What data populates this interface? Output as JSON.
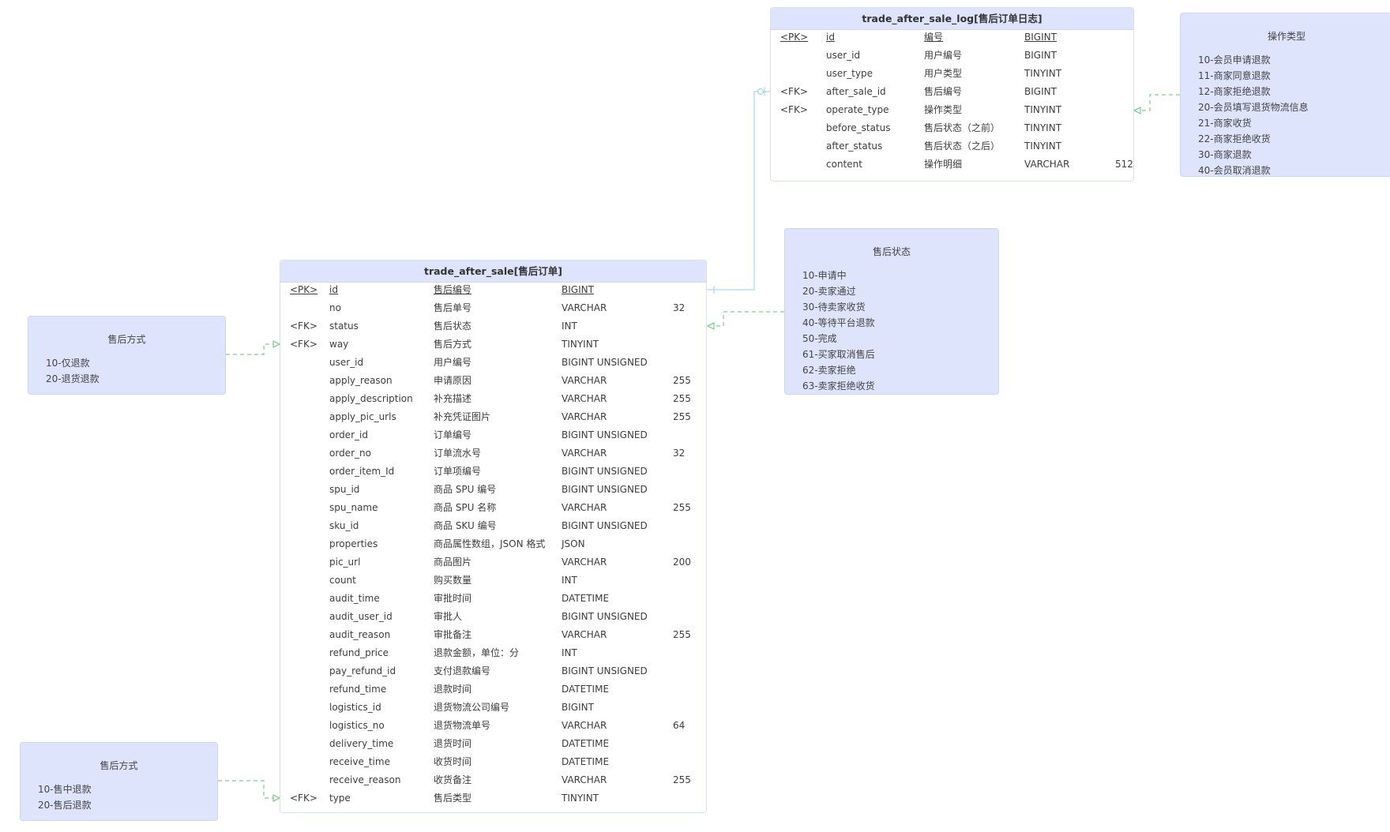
{
  "colors": {
    "header_bg": "#dde4fb",
    "note_bg": "#dde4fb",
    "entity_border": "#d8dff2",
    "relation_line": "#8fd0e8",
    "dependency_line": "#5cc46c"
  },
  "entities": {
    "log": {
      "title": "trade_after_sale_log[售后订单日志]",
      "rows": [
        {
          "key": "<PK>",
          "name": "id",
          "comment": "编号",
          "type": "BIGINT",
          "len": ""
        },
        {
          "key": "",
          "name": "user_id",
          "comment": "用户编号",
          "type": "BIGINT",
          "len": ""
        },
        {
          "key": "",
          "name": "user_type",
          "comment": "用户类型",
          "type": "TINYINT",
          "len": ""
        },
        {
          "key": "<FK>",
          "name": "after_sale_id",
          "comment": "售后编号",
          "type": "BIGINT",
          "len": ""
        },
        {
          "key": "<FK>",
          "name": "operate_type",
          "comment": "操作类型",
          "type": "TINYINT",
          "len": ""
        },
        {
          "key": "",
          "name": "before_status",
          "comment": "售后状态（之前）",
          "type": "TINYINT",
          "len": ""
        },
        {
          "key": "",
          "name": "after_status",
          "comment": "售后状态（之后）",
          "type": "TINYINT",
          "len": ""
        },
        {
          "key": "",
          "name": "content",
          "comment": "操作明细",
          "type": "VARCHAR",
          "len": "512"
        }
      ]
    },
    "sale": {
      "title": "trade_after_sale[售后订单]",
      "rows": [
        {
          "key": "<PK>",
          "name": "id",
          "comment": "售后编号",
          "type": "BIGINT",
          "len": ""
        },
        {
          "key": "",
          "name": "no",
          "comment": "售后单号",
          "type": "VARCHAR",
          "len": "32"
        },
        {
          "key": "<FK>",
          "name": "status",
          "comment": "售后状态",
          "type": "INT",
          "len": ""
        },
        {
          "key": "<FK>",
          "name": "way",
          "comment": "售后方式",
          "type": "TINYINT",
          "len": ""
        },
        {
          "key": "",
          "name": "user_id",
          "comment": "用户编号",
          "type": "BIGINT UNSIGNED",
          "len": ""
        },
        {
          "key": "",
          "name": "apply_reason",
          "comment": "申请原因",
          "type": "VARCHAR",
          "len": "255"
        },
        {
          "key": "",
          "name": "apply_description",
          "comment": "补充描述",
          "type": "VARCHAR",
          "len": "255"
        },
        {
          "key": "",
          "name": "apply_pic_urls",
          "comment": "补充凭证图片",
          "type": "VARCHAR",
          "len": "255"
        },
        {
          "key": "",
          "name": "order_id",
          "comment": "订单编号",
          "type": "BIGINT UNSIGNED",
          "len": ""
        },
        {
          "key": "",
          "name": "order_no",
          "comment": "订单流水号",
          "type": "VARCHAR",
          "len": "32"
        },
        {
          "key": "",
          "name": "order_item_Id",
          "comment": "订单项编号",
          "type": "BIGINT UNSIGNED",
          "len": ""
        },
        {
          "key": "",
          "name": "spu_id",
          "comment": "商品 SPU 编号",
          "type": "BIGINT UNSIGNED",
          "len": ""
        },
        {
          "key": "",
          "name": "spu_name",
          "comment": "商品 SPU 名称",
          "type": "VARCHAR",
          "len": "255"
        },
        {
          "key": "",
          "name": "sku_id",
          "comment": "商品 SKU 编号",
          "type": "BIGINT UNSIGNED",
          "len": ""
        },
        {
          "key": "",
          "name": "properties",
          "comment": "商品属性数组，JSON 格式",
          "type": "JSON",
          "len": ""
        },
        {
          "key": "",
          "name": "pic_url",
          "comment": "商品图片",
          "type": "VARCHAR",
          "len": "200"
        },
        {
          "key": "",
          "name": "count",
          "comment": "购买数量",
          "type": "INT",
          "len": ""
        },
        {
          "key": "",
          "name": "audit_time",
          "comment": "审批时间",
          "type": "DATETIME",
          "len": ""
        },
        {
          "key": "",
          "name": "audit_user_id",
          "comment": "审批人",
          "type": "BIGINT UNSIGNED",
          "len": ""
        },
        {
          "key": "",
          "name": "audit_reason",
          "comment": "审批备注",
          "type": "VARCHAR",
          "len": "255"
        },
        {
          "key": "",
          "name": "refund_price",
          "comment": "退款金额，单位：分",
          "type": "INT",
          "len": ""
        },
        {
          "key": "",
          "name": "pay_refund_id",
          "comment": "支付退款编号",
          "type": "BIGINT UNSIGNED",
          "len": ""
        },
        {
          "key": "",
          "name": "refund_time",
          "comment": "退款时间",
          "type": "DATETIME",
          "len": ""
        },
        {
          "key": "",
          "name": "logistics_id",
          "comment": "退货物流公司编号",
          "type": "BIGINT",
          "len": ""
        },
        {
          "key": "",
          "name": "logistics_no",
          "comment": "退货物流单号",
          "type": "VARCHAR",
          "len": "64"
        },
        {
          "key": "",
          "name": "delivery_time",
          "comment": "退货时间",
          "type": "DATETIME",
          "len": ""
        },
        {
          "key": "",
          "name": "receive_time",
          "comment": "收货时间",
          "type": "DATETIME",
          "len": ""
        },
        {
          "key": "",
          "name": "receive_reason",
          "comment": "收货备注",
          "type": "VARCHAR",
          "len": "255"
        },
        {
          "key": "<FK>",
          "name": "type",
          "comment": "售后类型",
          "type": "TINYINT",
          "len": ""
        }
      ]
    }
  },
  "notes": {
    "operate_type": {
      "title": "操作类型",
      "lines": [
        "10-会员申请退款",
        "11-商家同意退款",
        "12-商家拒绝退款",
        "20-会员填写退货物流信息",
        "21-商家收货",
        "22-商家拒绝收货",
        "30-商家退款",
        "40-会员取消退款"
      ]
    },
    "status": {
      "title": "售后状态",
      "lines": [
        "10-申请中",
        "20-卖家通过",
        "30-待卖家收货",
        "40-等待平台退款",
        "50-完成",
        "61-买家取消售后",
        "62-卖家拒绝",
        "63-卖家拒绝收货"
      ]
    },
    "way": {
      "title": "售后方式",
      "lines": [
        "10-仅退款",
        "20-退货退款"
      ]
    },
    "type": {
      "title": "售后方式",
      "lines": [
        "10-售中退款",
        "20-售后退款"
      ]
    }
  }
}
